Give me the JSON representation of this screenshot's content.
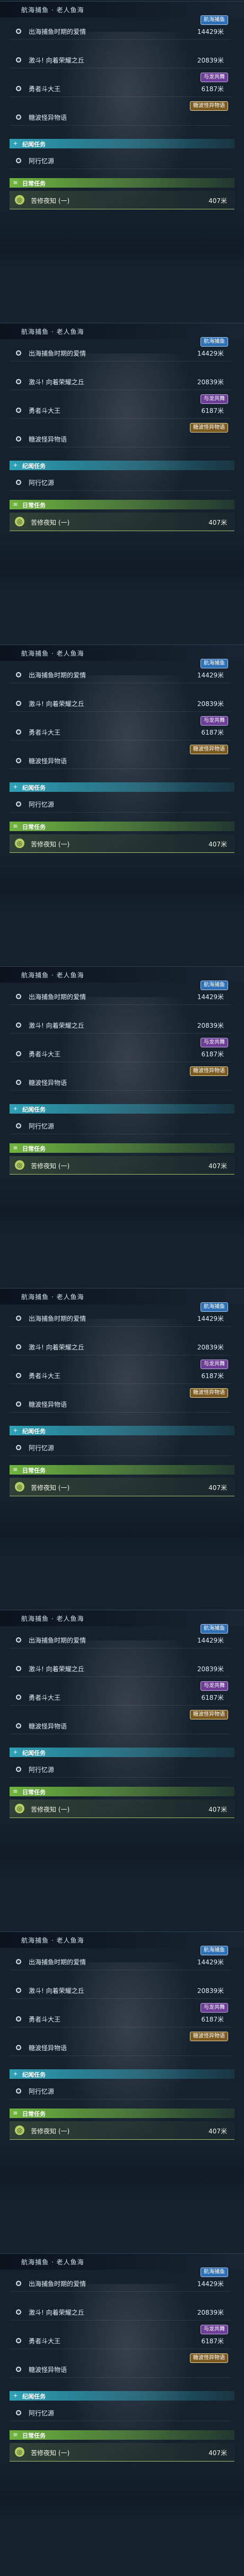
{
  "top_header": {
    "title": "航海捕鱼 · 老人鱼海",
    "faded_text": "航海捕鱼 · 老人鱼海"
  },
  "tasks": [
    {
      "label": "出海捕鱼时期的爱情",
      "distance": "14429米",
      "tag": "航海捕鱼",
      "tag_color": "blue"
    },
    {
      "label": "激斗! 向着荣耀之丘",
      "distance": "20839米",
      "tag": "",
      "tag_color": ""
    },
    {
      "label": "勇者斗大王",
      "distance": "6187米",
      "tag": "与龙共舞",
      "tag_color": "purple"
    },
    {
      "label": "糖波怪异物语",
      "distance": "",
      "tag": "糖波怪异物语",
      "tag_color": "gold"
    }
  ],
  "sections": {
    "memorial_label": "纪闻任务",
    "memorial_item": "阿行忆源",
    "daily_label": "日常任务",
    "daily_item": "苦修夜知 (一)",
    "daily_distance": "407米"
  },
  "colors": {
    "memorial_bar": "#2fa0b6",
    "daily_bar": "#6fb43f",
    "tag_blue": "#2c6fb5",
    "tag_purple": "#6d3e96",
    "tag_gold": "#7a5a1e"
  },
  "panel_count": 8
}
